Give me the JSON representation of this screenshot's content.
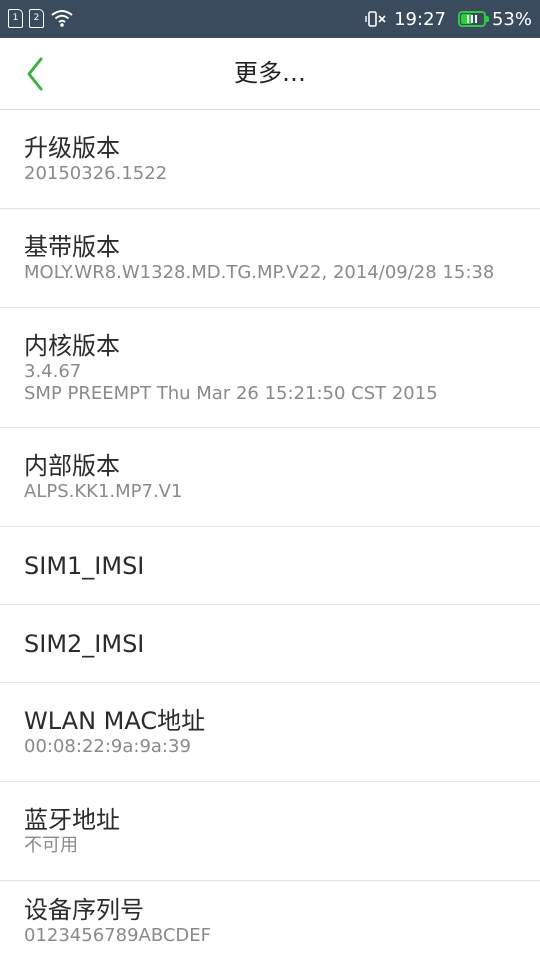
{
  "status_bar": {
    "sim1_label": "1",
    "sim2_label": "2",
    "time": "19:27",
    "battery_percent": "53%",
    "battery_level": 0.53,
    "icons": [
      "sim1-icon",
      "sim2-icon",
      "wifi-icon",
      "vibrate-icon",
      "battery-icon"
    ]
  },
  "header": {
    "title": "更多…",
    "back_icon": "chevron-left-icon",
    "accent_color": "#3cb043"
  },
  "items": [
    {
      "title": "升级版本",
      "value": "20150326.1522"
    },
    {
      "title": "基带版本",
      "value": "MOLY.WR8.W1328.MD.TG.MP.V22, 2014/09/28 15:38"
    },
    {
      "title": "内核版本",
      "value": "3.4.67",
      "value2": "SMP PREEMPT Thu Mar 26 15:21:50 CST 2015"
    },
    {
      "title": "内部版本",
      "value": "ALPS.KK1.MP7.V1"
    },
    {
      "title": "SIM1_IMSI"
    },
    {
      "title": "SIM2_IMSI"
    },
    {
      "title": "WLAN MAC地址",
      "value": "00:08:22:9a:9a:39"
    },
    {
      "title": "蓝牙地址",
      "value": "不可用"
    },
    {
      "title": "设备序列号",
      "value": "0123456789ABCDEF"
    }
  ]
}
